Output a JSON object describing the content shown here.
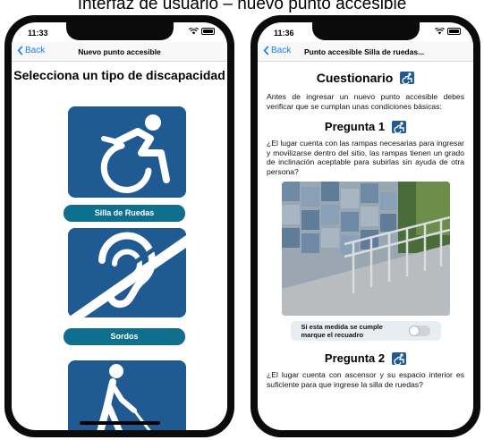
{
  "caption": "Interfaz de usuario – nuevo punto accesible",
  "left_phone": {
    "time": "11:33",
    "back_label": "Back",
    "nav_title": "Nuevo punto accesible",
    "heading": "Selecciona un tipo de discapacidad",
    "categories": [
      {
        "label": "Silla de Ruedas",
        "icon": "wheelchair-icon"
      },
      {
        "label": "Sordos",
        "icon": "deaf-icon"
      },
      {
        "label": "",
        "icon": "blind-icon"
      }
    ]
  },
  "right_phone": {
    "time": "11:36",
    "back_label": "Back",
    "nav_title": "Punto accesible Silla de ruedas...",
    "title": "Cuestionario",
    "intro": "Antes de ingresar un nuevo punto accesible debes verificar que se cumplan unas condiciones básicas:",
    "questions": [
      {
        "heading": "Pregunta 1",
        "text": "¿El lugar cuenta con las rampas necesarias para ingresar y movilizarse dentro del sitio, las rampas tienen un grado de inclinación aceptable para subirlas sin ayuda de otra persona?",
        "toggle_label": "Si esta medida se cumple marque el recuadro",
        "toggle_on": false
      },
      {
        "heading": "Pregunta 2",
        "text": "¿El lugar cuenta con ascensor y su espacio interior es suficiente para que ingrese la silla de ruedas?"
      }
    ]
  },
  "colors": {
    "tile_blue": "#1f5a92",
    "button_teal": "#0e6f8f",
    "ios_blue": "#1a7cf5"
  }
}
